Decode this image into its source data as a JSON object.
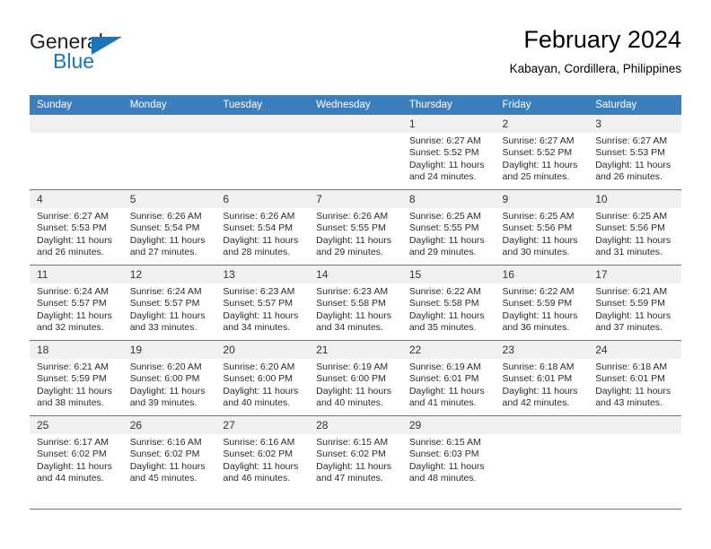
{
  "brand": {
    "name_top": "General",
    "name_bottom": "Blue",
    "flag_icon": "blue-triangle-flag-icon",
    "colors": {
      "text": "#231f20",
      "accent": "#1b75bb"
    }
  },
  "header": {
    "title": "February 2024",
    "subtitle": "Kabayan, Cordillera, Philippines"
  },
  "theme": {
    "header_row_bg": "#3d7ebd",
    "daynum_bg": "#f0f0f0",
    "grid_line": "#3d7ebd",
    "body_text": "#2b2b2b"
  },
  "calendar": {
    "weekday_headers": [
      "Sunday",
      "Monday",
      "Tuesday",
      "Wednesday",
      "Thursday",
      "Friday",
      "Saturday"
    ],
    "weeks": [
      [
        {
          "day": "",
          "empty": true,
          "lines": []
        },
        {
          "day": "",
          "empty": true,
          "lines": []
        },
        {
          "day": "",
          "empty": true,
          "lines": []
        },
        {
          "day": "",
          "empty": true,
          "lines": []
        },
        {
          "day": "1",
          "empty": false,
          "lines": [
            "Sunrise: 6:27 AM",
            "Sunset: 5:52 PM",
            "Daylight: 11 hours",
            "and 24 minutes."
          ]
        },
        {
          "day": "2",
          "empty": false,
          "lines": [
            "Sunrise: 6:27 AM",
            "Sunset: 5:52 PM",
            "Daylight: 11 hours",
            "and 25 minutes."
          ]
        },
        {
          "day": "3",
          "empty": false,
          "lines": [
            "Sunrise: 6:27 AM",
            "Sunset: 5:53 PM",
            "Daylight: 11 hours",
            "and 26 minutes."
          ]
        }
      ],
      [
        {
          "day": "4",
          "empty": false,
          "lines": [
            "Sunrise: 6:27 AM",
            "Sunset: 5:53 PM",
            "Daylight: 11 hours",
            "and 26 minutes."
          ]
        },
        {
          "day": "5",
          "empty": false,
          "lines": [
            "Sunrise: 6:26 AM",
            "Sunset: 5:54 PM",
            "Daylight: 11 hours",
            "and 27 minutes."
          ]
        },
        {
          "day": "6",
          "empty": false,
          "lines": [
            "Sunrise: 6:26 AM",
            "Sunset: 5:54 PM",
            "Daylight: 11 hours",
            "and 28 minutes."
          ]
        },
        {
          "day": "7",
          "empty": false,
          "lines": [
            "Sunrise: 6:26 AM",
            "Sunset: 5:55 PM",
            "Daylight: 11 hours",
            "and 29 minutes."
          ]
        },
        {
          "day": "8",
          "empty": false,
          "lines": [
            "Sunrise: 6:25 AM",
            "Sunset: 5:55 PM",
            "Daylight: 11 hours",
            "and 29 minutes."
          ]
        },
        {
          "day": "9",
          "empty": false,
          "lines": [
            "Sunrise: 6:25 AM",
            "Sunset: 5:56 PM",
            "Daylight: 11 hours",
            "and 30 minutes."
          ]
        },
        {
          "day": "10",
          "empty": false,
          "lines": [
            "Sunrise: 6:25 AM",
            "Sunset: 5:56 PM",
            "Daylight: 11 hours",
            "and 31 minutes."
          ]
        }
      ],
      [
        {
          "day": "11",
          "empty": false,
          "lines": [
            "Sunrise: 6:24 AM",
            "Sunset: 5:57 PM",
            "Daylight: 11 hours",
            "and 32 minutes."
          ]
        },
        {
          "day": "12",
          "empty": false,
          "lines": [
            "Sunrise: 6:24 AM",
            "Sunset: 5:57 PM",
            "Daylight: 11 hours",
            "and 33 minutes."
          ]
        },
        {
          "day": "13",
          "empty": false,
          "lines": [
            "Sunrise: 6:23 AM",
            "Sunset: 5:57 PM",
            "Daylight: 11 hours",
            "and 34 minutes."
          ]
        },
        {
          "day": "14",
          "empty": false,
          "lines": [
            "Sunrise: 6:23 AM",
            "Sunset: 5:58 PM",
            "Daylight: 11 hours",
            "and 34 minutes."
          ]
        },
        {
          "day": "15",
          "empty": false,
          "lines": [
            "Sunrise: 6:22 AM",
            "Sunset: 5:58 PM",
            "Daylight: 11 hours",
            "and 35 minutes."
          ]
        },
        {
          "day": "16",
          "empty": false,
          "lines": [
            "Sunrise: 6:22 AM",
            "Sunset: 5:59 PM",
            "Daylight: 11 hours",
            "and 36 minutes."
          ]
        },
        {
          "day": "17",
          "empty": false,
          "lines": [
            "Sunrise: 6:21 AM",
            "Sunset: 5:59 PM",
            "Daylight: 11 hours",
            "and 37 minutes."
          ]
        }
      ],
      [
        {
          "day": "18",
          "empty": false,
          "lines": [
            "Sunrise: 6:21 AM",
            "Sunset: 5:59 PM",
            "Daylight: 11 hours",
            "and 38 minutes."
          ]
        },
        {
          "day": "19",
          "empty": false,
          "lines": [
            "Sunrise: 6:20 AM",
            "Sunset: 6:00 PM",
            "Daylight: 11 hours",
            "and 39 minutes."
          ]
        },
        {
          "day": "20",
          "empty": false,
          "lines": [
            "Sunrise: 6:20 AM",
            "Sunset: 6:00 PM",
            "Daylight: 11 hours",
            "and 40 minutes."
          ]
        },
        {
          "day": "21",
          "empty": false,
          "lines": [
            "Sunrise: 6:19 AM",
            "Sunset: 6:00 PM",
            "Daylight: 11 hours",
            "and 40 minutes."
          ]
        },
        {
          "day": "22",
          "empty": false,
          "lines": [
            "Sunrise: 6:19 AM",
            "Sunset: 6:01 PM",
            "Daylight: 11 hours",
            "and 41 minutes."
          ]
        },
        {
          "day": "23",
          "empty": false,
          "lines": [
            "Sunrise: 6:18 AM",
            "Sunset: 6:01 PM",
            "Daylight: 11 hours",
            "and 42 minutes."
          ]
        },
        {
          "day": "24",
          "empty": false,
          "lines": [
            "Sunrise: 6:18 AM",
            "Sunset: 6:01 PM",
            "Daylight: 11 hours",
            "and 43 minutes."
          ]
        }
      ],
      [
        {
          "day": "25",
          "empty": false,
          "lines": [
            "Sunrise: 6:17 AM",
            "Sunset: 6:02 PM",
            "Daylight: 11 hours",
            "and 44 minutes."
          ]
        },
        {
          "day": "26",
          "empty": false,
          "lines": [
            "Sunrise: 6:16 AM",
            "Sunset: 6:02 PM",
            "Daylight: 11 hours",
            "and 45 minutes."
          ]
        },
        {
          "day": "27",
          "empty": false,
          "lines": [
            "Sunrise: 6:16 AM",
            "Sunset: 6:02 PM",
            "Daylight: 11 hours",
            "and 46 minutes."
          ]
        },
        {
          "day": "28",
          "empty": false,
          "lines": [
            "Sunrise: 6:15 AM",
            "Sunset: 6:02 PM",
            "Daylight: 11 hours",
            "and 47 minutes."
          ]
        },
        {
          "day": "29",
          "empty": false,
          "lines": [
            "Sunrise: 6:15 AM",
            "Sunset: 6:03 PM",
            "Daylight: 11 hours",
            "and 48 minutes."
          ]
        },
        {
          "day": "",
          "empty": true,
          "lines": []
        },
        {
          "day": "",
          "empty": true,
          "lines": []
        }
      ]
    ]
  }
}
